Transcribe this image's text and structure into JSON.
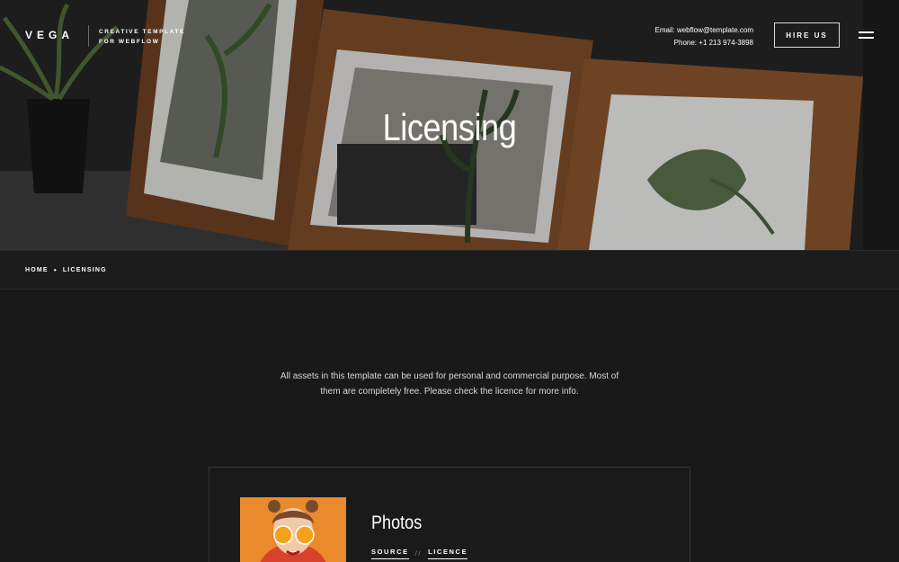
{
  "header": {
    "brand": "VEGA",
    "tagline_line1": "CREATIVE TEMPLATE",
    "tagline_line2": "FOR WEBFLOW",
    "email_label": "Email:",
    "email": "webflow@template.com",
    "phone_label": "Phone:",
    "phone": "+1 213 974-3898",
    "cta": "HIRE US",
    "menu_icon": "hamburger-menu-icon"
  },
  "hero": {
    "title": "Licensing"
  },
  "breadcrumb": {
    "home": "HOME",
    "separator": "•",
    "current": "LICENSING"
  },
  "intro": {
    "text": "All assets in this template can be used for personal and commercial purpose. Most of them are completely free. Please check the licence for more info."
  },
  "card": {
    "title": "Photos",
    "source_label": "SOURCE",
    "separator": "//",
    "licence_label": "LICENCE"
  },
  "colors": {
    "background": "#191919",
    "text": "#ffffff",
    "thumb_bg": "#e98a2c"
  }
}
